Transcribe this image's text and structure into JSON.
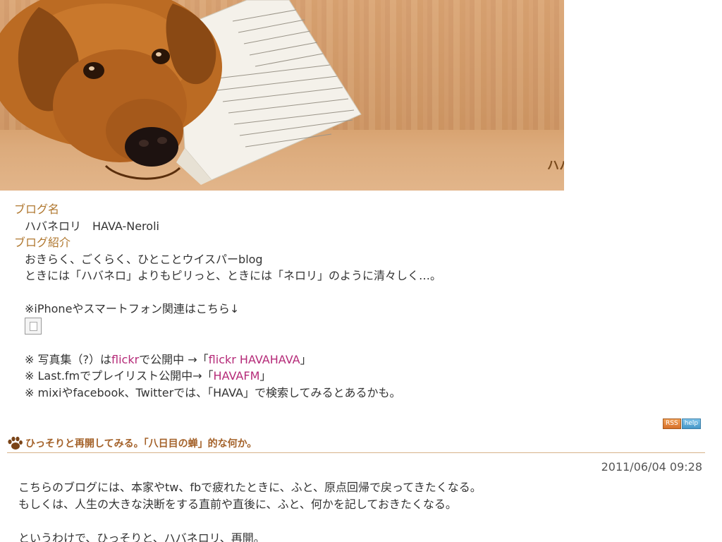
{
  "header": {
    "blog_title": "ハバネロリ　HAVA-Neroli"
  },
  "blog_info": {
    "name_label": "ブログ名",
    "name_value": "ハバネロリ　HAVA-Neroli",
    "intro_label": "ブログ紹介",
    "intro_line1": "おきらく、ごくらく、ひとことウイスパーblog",
    "intro_line2": "ときには「ハバネロ」よりもピリっと、ときには「ネロリ」のように清々しく…。",
    "iphone_line": "※iPhoneやスマートフォン関連はこちら↓",
    "photo_prefix": "※ 写真集（?）は",
    "photo_link1": "flickr",
    "photo_middle": "で公開中 →「",
    "photo_link2": "flickr HAVAHAVA",
    "photo_suffix": "」",
    "lastfm_prefix": "※ Last.fmでプレイリスト公開中→「",
    "lastfm_link": "HAVAFM",
    "lastfm_suffix": "」",
    "social_line": "※ mixiやfacebook、Twitterでは、「HAVA」で検索してみるとあるかも。"
  },
  "rss": {
    "rss_label": "RSS",
    "help_label": "help"
  },
  "entry": {
    "title": "ひっそりと再開してみる。「八日目の蝉」的な何か。",
    "date": "2011/06/04 09:28",
    "body": [
      "こちらのブログには、本家やtw、fbで疲れたときに、ふと、原点回帰で戻ってきたくなる。",
      "もしくは、人生の大きな決断をする直前や直後に、ふと、何かを記しておきたくなる。",
      "",
      "というわけで、ひっそりと、ハバネロリ、再開。"
    ]
  },
  "colors": {
    "title_brown": "#7a4a1c",
    "label_gold": "#b07830",
    "link_pink": "#b52a78",
    "entry_title": "#a4622a",
    "rss_orange": "#d6702a",
    "help_blue": "#4597c8"
  },
  "icons": {
    "entry_marker": "paw-icon",
    "broken_image": "broken-image-icon"
  }
}
